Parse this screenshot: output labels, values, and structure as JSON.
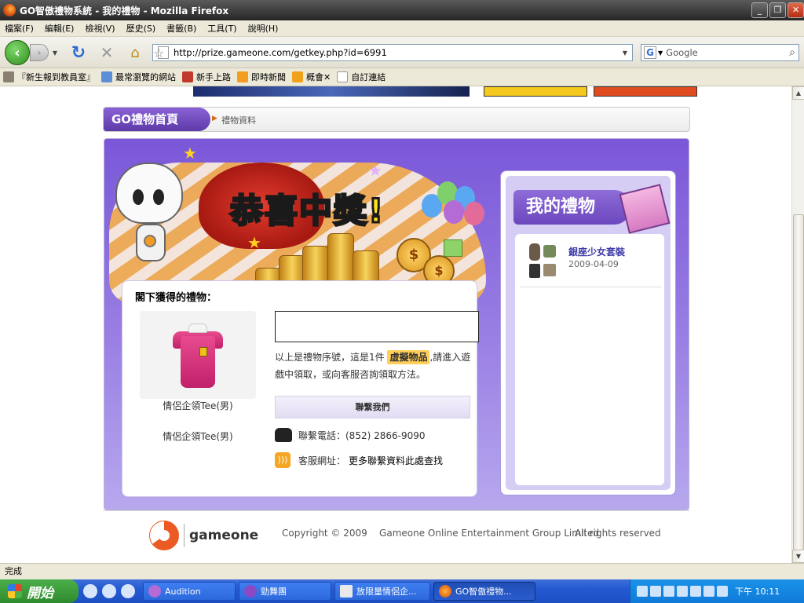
{
  "window": {
    "title": "GO智傲禮物系統 - 我的禮物 - Mozilla Firefox",
    "btn_min": "_",
    "btn_max": "❐",
    "btn_close": "✕"
  },
  "menu": [
    "檔案(F)",
    "編輯(E)",
    "檢視(V)",
    "歷史(S)",
    "書籤(B)",
    "工具(T)",
    "說明(H)"
  ],
  "nav": {
    "url": "http://prize.gameone.com/getkey.php?id=6991",
    "search_placeholder": "Google",
    "search_engine": "G"
  },
  "bookmarks": [
    "『新生報到教員室』",
    "最常瀏覽的網站",
    "新手上路",
    "即時新聞",
    "概會✕",
    "自訂連結"
  ],
  "page": {
    "breadcrumb": {
      "home": "GO禮物首頁",
      "current": "禮物資料"
    },
    "banner": {
      "congrats": "恭喜中獎!"
    },
    "gift": {
      "label": "閣下獲得的禮物：",
      "name1": "情侶企領Tee(男)",
      "name2": "情侶企領Tee(男)",
      "desc_before": "以上是禮物序號，這是1件",
      "desc_highlight": "虛擬物品",
      "desc_after": ",請進入遊戲中領取，或向客服咨詢領取方法。",
      "contact_button": "聯繫我們",
      "phone": "聯繫電話：(852) 2866-9090",
      "web_label": "客服網址：",
      "web_link": "更多聯繫資料此處查找"
    },
    "my_gifts": {
      "title": "我的禮物",
      "items": [
        {
          "name": "銀座少女套裝",
          "date": "2009-04-09"
        }
      ]
    },
    "footer": {
      "logo_text": "gameone",
      "copyright": "Copyright © 2009    Gameone Online Entertainment Group Limited",
      "rights": "All rights reserved"
    }
  },
  "status": "完成",
  "taskbar": {
    "start": "開始",
    "tasks": [
      "Audition",
      "勁舞團",
      "放限量情侶企...",
      "GO智傲禮物..."
    ],
    "clock": "下午 10:11"
  },
  "colors": {
    "accent_purple": "#6b47bd",
    "highlight": "#ffcf57",
    "taskbar": "#245ad2",
    "brand_orange": "#ec5a24"
  }
}
